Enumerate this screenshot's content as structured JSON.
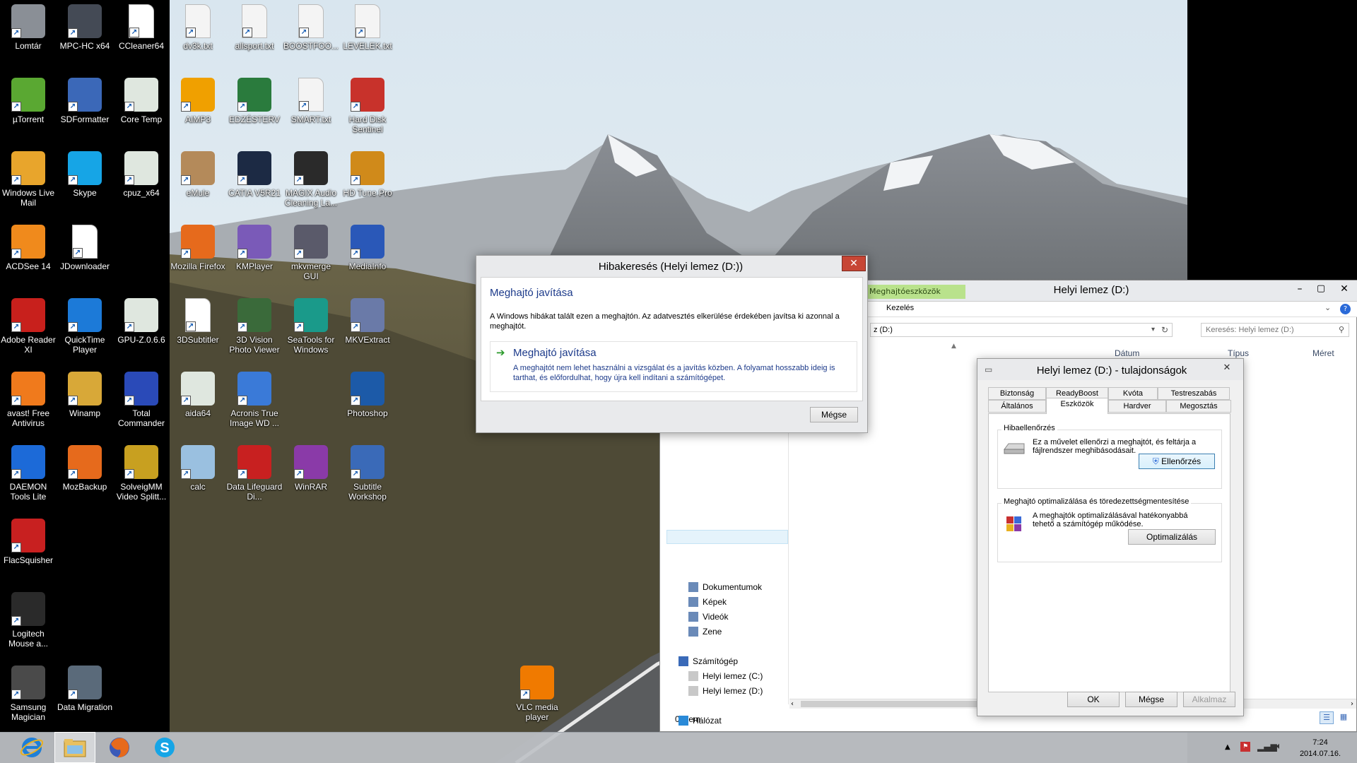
{
  "desktop": {
    "icons": [
      {
        "label": "Lomtár",
        "icon": "recycle-bin-icon",
        "color": "#8a8f96"
      },
      {
        "label": "MPC-HC x64",
        "icon": "mpc-hc-icon",
        "color": "#444a55"
      },
      {
        "label": "CCleaner64",
        "icon": "file-icon",
        "color": "#ffffff"
      },
      {
        "label": "dv3k.txt",
        "icon": "text-file-icon",
        "color": "#f4f4f4"
      },
      {
        "label": "allsport.txt",
        "icon": "text-file-icon",
        "color": "#f4f4f4"
      },
      {
        "label": "BOOSTFOO...",
        "icon": "text-file-icon",
        "color": "#f4f4f4"
      },
      {
        "label": "LEVELEK.txt",
        "icon": "text-file-icon",
        "color": "#f4f4f4"
      },
      {
        "label": "µTorrent",
        "icon": "utorrent-icon",
        "color": "#5aa832"
      },
      {
        "label": "SDFormatter",
        "icon": "sdformatter-icon",
        "color": "#3b68b8"
      },
      {
        "label": "Core Temp",
        "icon": "app-window-icon",
        "color": "#dfe7df"
      },
      {
        "label": "AIMP3",
        "icon": "aimp-icon",
        "color": "#f0a000"
      },
      {
        "label": "EDZÉSTERV",
        "icon": "excel-file-icon",
        "color": "#2a7b3d"
      },
      {
        "label": "SMART.txt",
        "icon": "text-file-icon",
        "color": "#f4f4f4"
      },
      {
        "label": "Hard Disk Sentinel",
        "icon": "hdsentinel-icon",
        "color": "#c8322b"
      },
      {
        "label": "Windows Live Mail",
        "icon": "live-mail-icon",
        "color": "#e8a52c"
      },
      {
        "label": "Skype",
        "icon": "skype-icon",
        "color": "#16a5e6"
      },
      {
        "label": "cpuz_x64",
        "icon": "app-window-icon",
        "color": "#dfe7df"
      },
      {
        "label": "eMule",
        "icon": "emule-icon",
        "color": "#b48a5a"
      },
      {
        "label": "CATIA V5R21",
        "icon": "catia-icon",
        "color": "#1c2a44"
      },
      {
        "label": "MAGIX Audio Cleaning La...",
        "icon": "magix-icon",
        "color": "#2a2a2a"
      },
      {
        "label": "HD Tune Pro",
        "icon": "hdtune-icon",
        "color": "#d08a1a"
      },
      {
        "label": "ACDSee 14",
        "icon": "acdsee-icon",
        "color": "#f08a1c"
      },
      {
        "label": "JDownloader",
        "icon": "file-icon",
        "color": "#ffffff"
      },
      {
        "label": "Mozilla Firefox",
        "icon": "firefox-icon",
        "color": "#e66a1c"
      },
      {
        "label": "KMPlayer",
        "icon": "kmplayer-icon",
        "color": "#7a5ab8"
      },
      {
        "label": "mkvmerge GUI",
        "icon": "mkvmerge-icon",
        "color": "#5a5a6a"
      },
      {
        "label": "MediaInfo",
        "icon": "mediainfo-icon",
        "color": "#2a58b8"
      },
      {
        "label": "Adobe Reader XI",
        "icon": "adobe-reader-icon",
        "color": "#c8201c"
      },
      {
        "label": "QuickTime Player",
        "icon": "quicktime-icon",
        "color": "#1c7ad8"
      },
      {
        "label": "GPU-Z.0.6.6",
        "icon": "app-window-icon",
        "color": "#dfe7df"
      },
      {
        "label": "3DSubtitler",
        "icon": "file-icon",
        "color": "#ffffff"
      },
      {
        "label": "3D Vision Photo Viewer",
        "icon": "3dvision-icon",
        "color": "#3a6a3a"
      },
      {
        "label": "SeaTools for Windows",
        "icon": "seatools-icon",
        "color": "#1a9a8a"
      },
      {
        "label": "MKVExtract",
        "icon": "mkvextract-icon",
        "color": "#6a7aa8"
      },
      {
        "label": "avast! Free Antivirus",
        "icon": "avast-icon",
        "color": "#f07a1c"
      },
      {
        "label": "Winamp",
        "icon": "winamp-icon",
        "color": "#d8a838"
      },
      {
        "label": "Total Commander",
        "icon": "totalcmd-icon",
        "color": "#2a4ab8"
      },
      {
        "label": "aida64",
        "icon": "app-window-icon",
        "color": "#dfe7df"
      },
      {
        "label": "Acronis True Image WD ...",
        "icon": "acronis-icon",
        "color": "#3a7ad8"
      },
      {
        "label": "Photoshop",
        "icon": "photoshop-icon",
        "color": "#1c5aa8"
      },
      {
        "label": "DAEMON Tools Lite",
        "icon": "daemon-tools-icon",
        "color": "#1c6ad8"
      },
      {
        "label": "MozBackup",
        "icon": "mozbackup-icon",
        "color": "#e66a1c"
      },
      {
        "label": "SolveigMM Video Splitt...",
        "icon": "solveigmm-icon",
        "color": "#c8a020"
      },
      {
        "label": "calc",
        "icon": "calculator-icon",
        "color": "#9ac0e0"
      },
      {
        "label": "Data Lifeguard Di...",
        "icon": "data-lifeguard-icon",
        "color": "#c82020"
      },
      {
        "label": "WinRAR",
        "icon": "winrar-icon",
        "color": "#8a3aa8"
      },
      {
        "label": "Subtitle Workshop",
        "icon": "subtitle-workshop-icon",
        "color": "#3a6ab8"
      },
      {
        "label": "FlacSquisher",
        "icon": "flacsquisher-icon",
        "color": "#c82020"
      },
      {
        "label": "Logitech Mouse a...",
        "icon": "logitech-icon",
        "color": "#2a2a2a"
      },
      {
        "label": "Samsung Magician",
        "icon": "samsung-magician-icon",
        "color": "#4a4a4a"
      },
      {
        "label": "Data Migration",
        "icon": "data-migration-icon",
        "color": "#5a6a7a"
      },
      {
        "label": "VLC media player",
        "icon": "vlc-icon",
        "color": "#f07a00"
      }
    ]
  },
  "errorDialog": {
    "title": "Hibakeresés (Helyi lemez (D:))",
    "heading": "Meghajtó javítása",
    "message": "A Windows hibákat talált ezen a meghajtón. Az adatvesztés elkerülése érdekében javítsa ki azonnal a meghajtót.",
    "optionTitle": "Meghajtó javítása",
    "optionText": "A meghajtót nem lehet használni a vizsgálat és a javítás közben. A folyamat hosszabb ideig is tarthat, és előfordulhat, hogy újra kell indítani a számítógépet.",
    "cancel": "Mégse"
  },
  "explorer": {
    "title": "Helyi lemez (D:)",
    "contextTab": "Meghajtóeszközök",
    "ribbonTab": "Kezelés",
    "address": "z (D:)",
    "searchPlaceholder": "Keresés: Helyi lemez (D:)",
    "columns": {
      "date": "Dátum",
      "type": "Típus",
      "size": "Méret"
    },
    "nav": [
      {
        "label": "Dokumentumok",
        "icon": "documents-icon"
      },
      {
        "label": "Képek",
        "icon": "pictures-icon"
      },
      {
        "label": "Videók",
        "icon": "videos-icon"
      },
      {
        "label": "Zene",
        "icon": "music-icon"
      },
      {
        "label": "Számítógép",
        "icon": "computer-icon"
      },
      {
        "label": "Helyi lemez (C:)",
        "icon": "drive-icon"
      },
      {
        "label": "Helyi lemez (D:)",
        "icon": "drive-icon"
      },
      {
        "label": "Hálózat",
        "icon": "network-icon"
      }
    ],
    "status": "0 elem"
  },
  "props": {
    "title": "Helyi lemez (D:) - tulajdonságok",
    "tabsRow1": [
      "Biztonság",
      "ReadyBoost",
      "Kvóta",
      "Testreszabás"
    ],
    "tabsRow2": [
      "Általános",
      "Eszközök",
      "Hardver",
      "Megosztás"
    ],
    "errorCheck": {
      "group": "Hibaellenőrzés",
      "text": "Ez a művelet ellenőrzi a meghajtót, és feltárja a fájlrendszer meghibásodásait.",
      "button": "Ellenőrzés"
    },
    "optimize": {
      "group": "Meghajtó optimalizálása és töredezettségmentesítése",
      "text": "A meghajtók optimalizálásával hatékonyabbá tehető a számítógép működése.",
      "button": "Optimalizálás"
    },
    "ok": "OK",
    "cancel": "Mégse",
    "apply": "Alkalmaz"
  },
  "taskbar": {
    "time": "7:24",
    "date": "2014.07.16.",
    "apps": [
      "internet-explorer-icon",
      "file-explorer-icon",
      "firefox-icon",
      "skype-icon"
    ]
  }
}
